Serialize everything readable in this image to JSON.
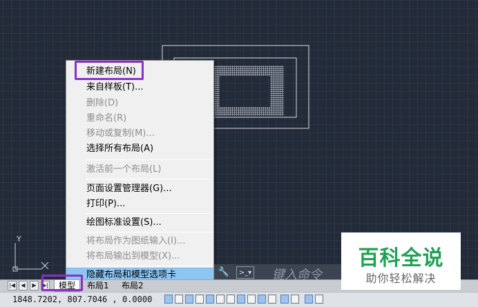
{
  "context_menu": {
    "items": [
      {
        "label": "新建布局(N)",
        "enabled": true
      },
      {
        "label": "来自样板(T)...",
        "enabled": true
      },
      {
        "label": "删除(D)",
        "enabled": false
      },
      {
        "label": "重命名(R)",
        "enabled": false
      },
      {
        "label": "移动或复制(M)...",
        "enabled": false
      },
      {
        "label": "选择所有布局(A)",
        "enabled": true
      },
      {
        "label": "激活前一个布局(L)",
        "enabled": false
      },
      {
        "label": "页面设置管理器(G)...",
        "enabled": true
      },
      {
        "label": "打印(P)...",
        "enabled": true
      },
      {
        "label": "绘图标准设置(S)...",
        "enabled": true
      },
      {
        "label": "将布局作为图纸输入(I)...",
        "enabled": false
      },
      {
        "label": "将布局输出到模型(X)...",
        "enabled": false
      },
      {
        "label": "隐藏布局和模型选项卡",
        "enabled": true,
        "highlighted": true
      }
    ]
  },
  "ucs": {
    "y_label": "Y",
    "x_label": "X"
  },
  "command_line": {
    "placeholder": "键入命令",
    "prompt_icon": "command-prompt-icon",
    "tools_icon": "wrench-icon"
  },
  "layout_tabs": {
    "tabs": [
      "模型",
      "布局1",
      "布局2"
    ],
    "active": "模型"
  },
  "status_bar": {
    "coordinates": "1848.7202, 807.7046 , 0.0000",
    "command_hint": "命令"
  },
  "watermark": {
    "title": "百科全说",
    "subtitle": "助你轻松解决"
  },
  "colors": {
    "canvas_bg": "#232b39",
    "menu_highlight": "#8ec6f3",
    "annotation_purple": "#8b2fc9",
    "watermark_green": "#1fa154"
  }
}
